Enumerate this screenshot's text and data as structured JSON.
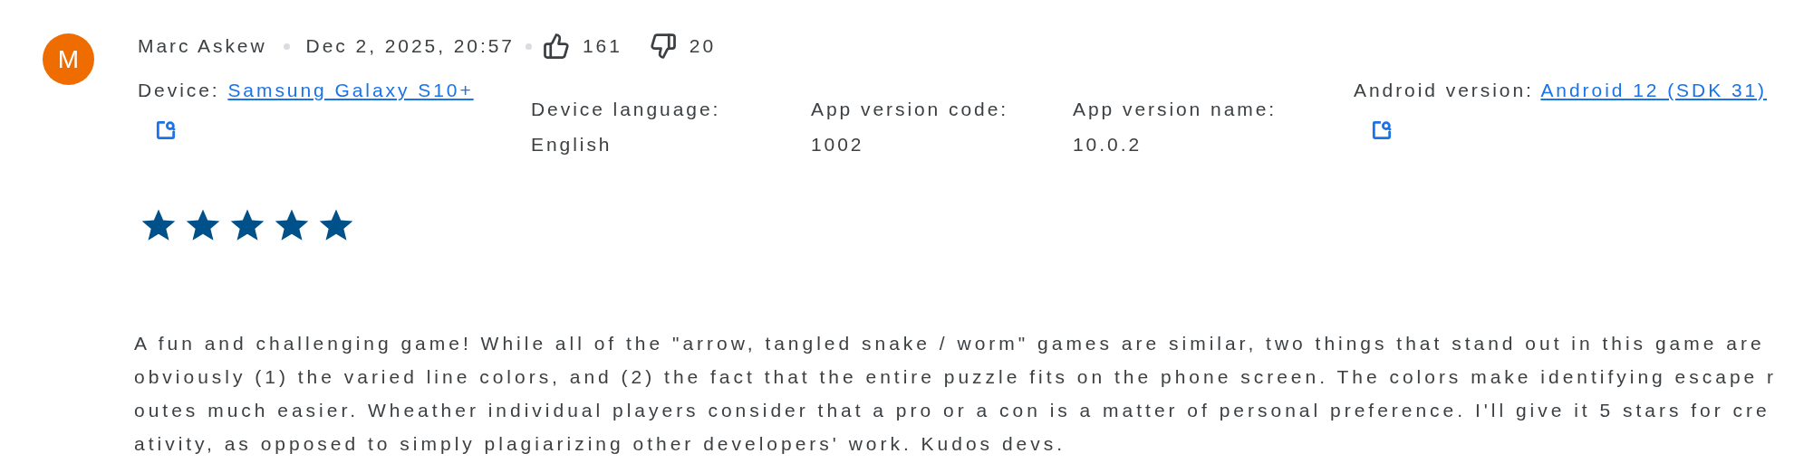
{
  "review": {
    "avatar_letter": "M",
    "author": "Marc Askew",
    "date": "Dec 2, 2025, 20:57",
    "likes": "161",
    "dislikes": "20"
  },
  "details": [
    {
      "kind": "link",
      "label": "Device:",
      "value": "Samsung Galaxy S10+"
    },
    {
      "kind": "text",
      "label": "Device language:",
      "value": "English"
    },
    {
      "kind": "text",
      "label": "App version code:",
      "value": "1002"
    },
    {
      "kind": "text",
      "label": "App version name:",
      "value": "10.0.2"
    },
    {
      "kind": "link",
      "label": "Android version:",
      "value": "Android 12 (SDK 31)"
    }
  ],
  "rating": {
    "stars": 5
  },
  "body": {
    "lines": [
      "A fun and challenging game! While all of the \"arrow, tangled snake / worm\" games are similar, two things that stand out in this game are",
      "obviously (1) the varied line colors, and (2) the fact that the entire puzzle fits on the phone screen. The colors make identifying escape r",
      "outes much easier. Wheather individual players consider that a pro or a con is a matter of personal preference. I'll give it 5 stars for cre",
      "ativity, as opposed to simply plagiarizing other developers' work. Kudos devs."
    ]
  }
}
